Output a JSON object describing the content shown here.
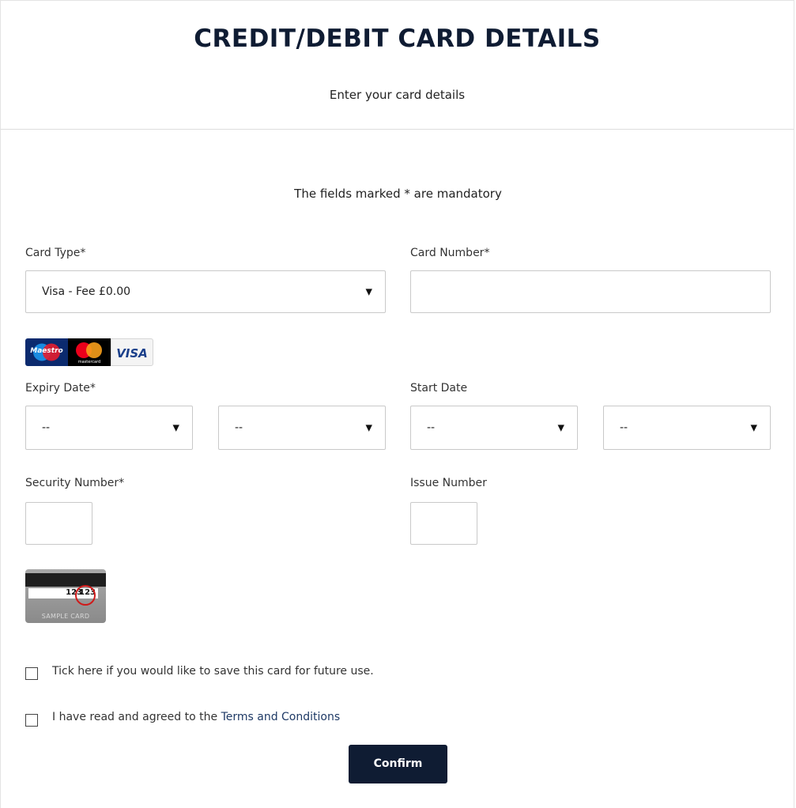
{
  "header": {
    "title": "CREDIT/DEBIT CARD DETAILS",
    "subtitle": "Enter your card details"
  },
  "form": {
    "mandatory_note": "The fields marked * are mandatory",
    "card_type": {
      "label": "Card Type*",
      "value": "Visa - Fee £0.00"
    },
    "card_number": {
      "label": "Card Number*",
      "value": ""
    },
    "card_logos": [
      {
        "name": "maestro-logo",
        "text": "Maestro"
      },
      {
        "name": "mastercard-logo",
        "text": "mastercard"
      },
      {
        "name": "visa-logo",
        "text": "VISA"
      }
    ],
    "expiry_date": {
      "label": "Expiry Date*",
      "month": "--",
      "year": "--"
    },
    "start_date": {
      "label": "Start Date",
      "month": "--",
      "year": "--"
    },
    "security_number": {
      "label": "Security Number*",
      "value": ""
    },
    "issue_number": {
      "label": "Issue Number",
      "value": ""
    },
    "sample_card": {
      "code_left": "123",
      "code_right": "123",
      "label": "SAMPLE CARD"
    },
    "save_card": {
      "text": "Tick here if you would like to save this card for future use.",
      "checked": false
    },
    "terms": {
      "prefix": "I have read and agreed to the ",
      "link": "Terms and Conditions",
      "checked": false
    },
    "confirm_label": "Confirm"
  },
  "icons": {
    "dropdown": "chevron-down-icon",
    "accent": "#0f1c33",
    "link_color": "#1f3a66",
    "cvv_ring": "#d01a1a"
  }
}
